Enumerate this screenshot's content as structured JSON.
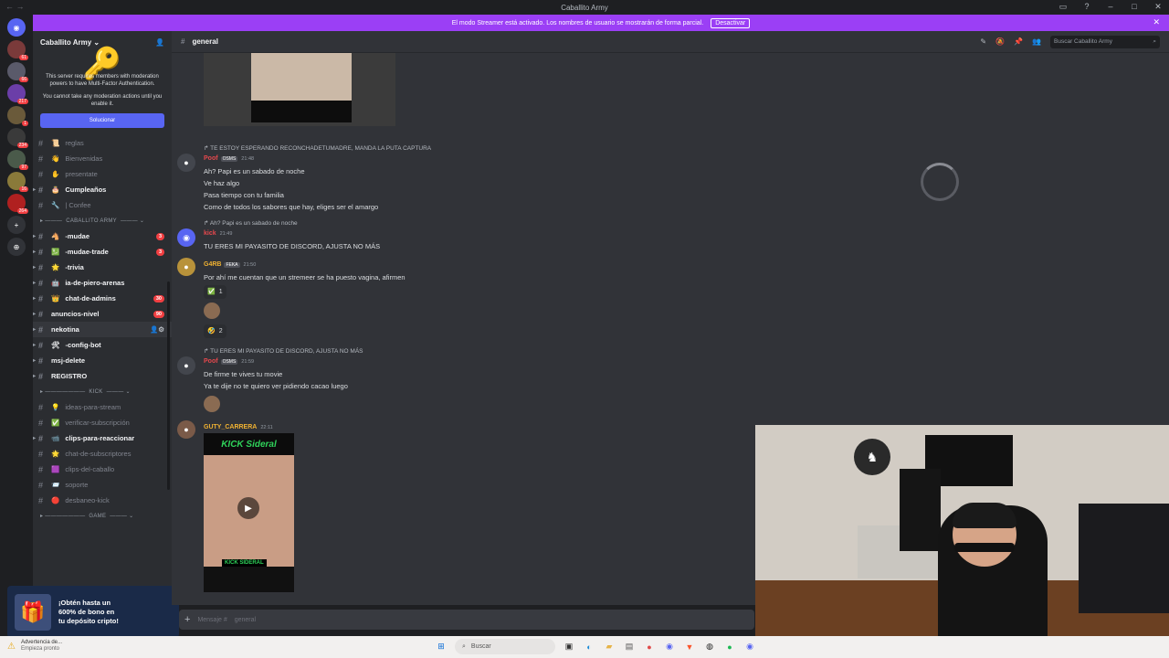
{
  "window": {
    "title": "Caballito Army"
  },
  "streamer_bar": {
    "text": "El modo Streamer está activado. Los nombres de usuario se mostrarán de forma parcial.",
    "button": "Desactivar"
  },
  "servers": [
    {
      "icon": "home-icon",
      "badge": ""
    },
    {
      "icon": "server-1",
      "badge": "61"
    },
    {
      "icon": "server-2",
      "badge": "66"
    },
    {
      "icon": "server-3",
      "badge": "217"
    },
    {
      "icon": "server-4",
      "badge": "1"
    },
    {
      "icon": "server-5",
      "badge": "234"
    },
    {
      "icon": "server-6",
      "badge": "97"
    },
    {
      "icon": "server-7",
      "badge": "16"
    },
    {
      "icon": "server-8",
      "badge": "264"
    }
  ],
  "sidebar": {
    "server_name": "Caballito Army",
    "mfa": {
      "text1": "This server requires members with moderation powers to have Multi-Factor Authentication.",
      "text2": "You cannot take any moderation actions until you enable it.",
      "button": "Solucionar"
    },
    "channels_top": [
      {
        "label": "reglas",
        "emoji": "📜",
        "unread": false
      },
      {
        "label": "Bienvenidas",
        "emoji": "👋",
        "unread": false
      },
      {
        "label": "presentate",
        "emoji": "✋",
        "unread": false
      },
      {
        "label": "Cumpleaños",
        "emoji": "🎂",
        "unread": true
      },
      {
        "label": "| Confee",
        "emoji": "🔧",
        "unread": false
      }
    ],
    "category1": "CABALLITO ARMY",
    "channels_mid": [
      {
        "label": "-mudae",
        "emoji": "🐴",
        "unread": true,
        "badge": "3"
      },
      {
        "label": "-mudae-trade",
        "emoji": "💹",
        "unread": true,
        "badge": "3"
      },
      {
        "label": "-trivia",
        "emoji": "🌟",
        "unread": true,
        "badge": ""
      },
      {
        "label": "ia-de-piero-arenas",
        "emoji": "🤖",
        "unread": true,
        "badge": ""
      },
      {
        "label": "chat-de-admins",
        "emoji": "👑",
        "unread": true,
        "badge": "30"
      },
      {
        "label": "anuncios-nivel",
        "emoji": "",
        "unread": true,
        "badge": "90"
      },
      {
        "label": "nekotina",
        "emoji": "",
        "unread": true,
        "badge": ""
      },
      {
        "label": "-config-bot",
        "emoji": "🛠",
        "unread": true,
        "badge": ""
      },
      {
        "label": "msj-delete",
        "emoji": "",
        "unread": true,
        "badge": ""
      },
      {
        "label": "REGISTRO",
        "emoji": "",
        "unread": true,
        "badge": ""
      }
    ],
    "category2": "KICK",
    "channels_kick": [
      {
        "label": "ideas-para-stream",
        "emoji": "💡",
        "unread": false
      },
      {
        "label": "verificar-subscripción",
        "emoji": "✅",
        "unread": false
      },
      {
        "label": "clips-para-reaccionar",
        "emoji": "📹",
        "unread": true
      },
      {
        "label": "chat-de-subscriptores",
        "emoji": "🌟",
        "unread": false
      },
      {
        "label": "clips-del-caballo",
        "emoji": "🟪",
        "unread": false
      },
      {
        "label": "soporte",
        "emoji": "📨",
        "unread": false
      },
      {
        "label": "desbaneo-kick",
        "emoji": "🔴",
        "unread": false
      }
    ],
    "category3": "GAME"
  },
  "promo": {
    "line1": "¡Obtén hasta un",
    "line2": "600% de bono en",
    "line3": "tu depósito cripto!"
  },
  "chat_header": {
    "channel": "general",
    "search_placeholder": "Buscar Caballito Army"
  },
  "messages": [
    {
      "reply": "TE ESTOY ESPERANDO RECONCHADETUMADRE, MANDA LA PUTA CAPTURA",
      "author": "Poof",
      "role": "OSMS",
      "time": "21:48",
      "color": "#e5484d",
      "lines": [
        "Ah? Papi es un sabado de noche",
        "Ve haz algo",
        "Pasa tiempo con tu familia",
        "Como de todos los sabores que hay, eliges ser el amargo"
      ]
    },
    {
      "reply": "Ah? Papi es un sabado de noche",
      "author": "kick",
      "role": "",
      "time": "21:49",
      "color": "#e5484d",
      "lines": [
        "TU ERES MI PAYASITO DE DISCORD, AJUSTA NO MÁS"
      ]
    },
    {
      "reply": "",
      "author": "G4RB",
      "role": "FEKA",
      "time": "21:50",
      "color": "#f0b232",
      "lines": [
        "Por ahí me cuentan que un stremeer se ha puesto vagina, afirmen"
      ],
      "reactions": [
        {
          "emoji": "✅",
          "count": "1"
        },
        {
          "emoji": "🤣",
          "count": "2"
        }
      ]
    },
    {
      "reply": "TU ERES MI PAYASITO DE DISCORD, AJUSTA NO MÁS",
      "author": "Poof",
      "role": "OSMS",
      "time": "21:59",
      "color": "#e5484d",
      "lines": [
        "De firme te vives tu movie",
        "Ya te dije no te quiero ver pidiendo cacao luego"
      ]
    },
    {
      "reply": "",
      "author": "GUTY_CARRERA",
      "role": "",
      "time": "22:11",
      "color": "#f0b232",
      "lines": []
    }
  ],
  "video": {
    "title": "KICK Sideral",
    "caption": "KICK SIDERAL"
  },
  "composer": {
    "placeholder": "Mensaje #",
    "channel": "general"
  },
  "taskbar": {
    "warn1": "Advertencia de...",
    "warn2": "Empieza pronto",
    "search": "Buscar"
  }
}
